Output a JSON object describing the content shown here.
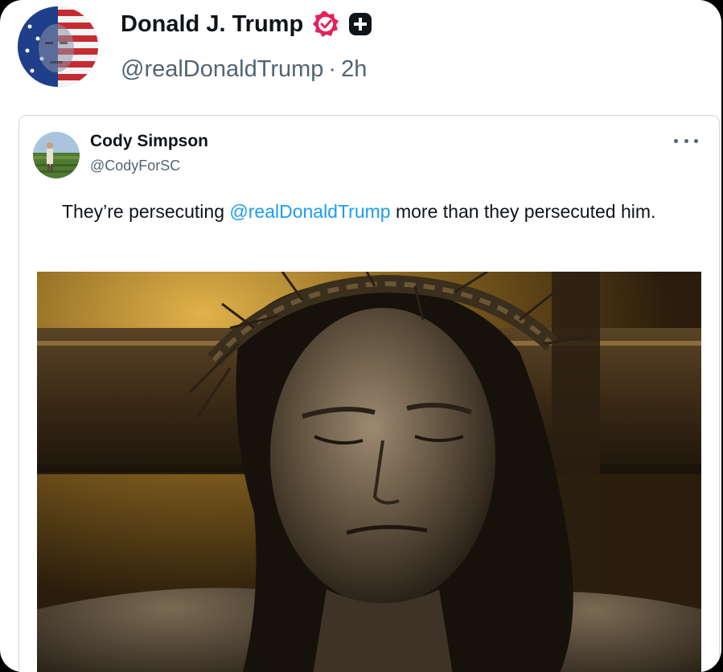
{
  "post": {
    "author_name": "Donald J. Trump",
    "author_handle": "@realDonaldTrump",
    "separator": "·",
    "time_ago": "2h",
    "avatar_icon": "flag-face-avatar-icon",
    "verified_icon": "verified-badge-icon",
    "plus_icon": "plus-badge-icon",
    "colors": {
      "verified": "#e0245e",
      "plus": "#0f1419"
    }
  },
  "quoted_post": {
    "author_name": "Cody Simpson",
    "author_handle": "@CodyForSC",
    "text_before": "They’re persecuting ",
    "mention": "@realDonaldTrump",
    "text_after": " more than they persecuted him.",
    "more_icon": "more-options-icon",
    "mention_color": "#1d9bf0"
  }
}
